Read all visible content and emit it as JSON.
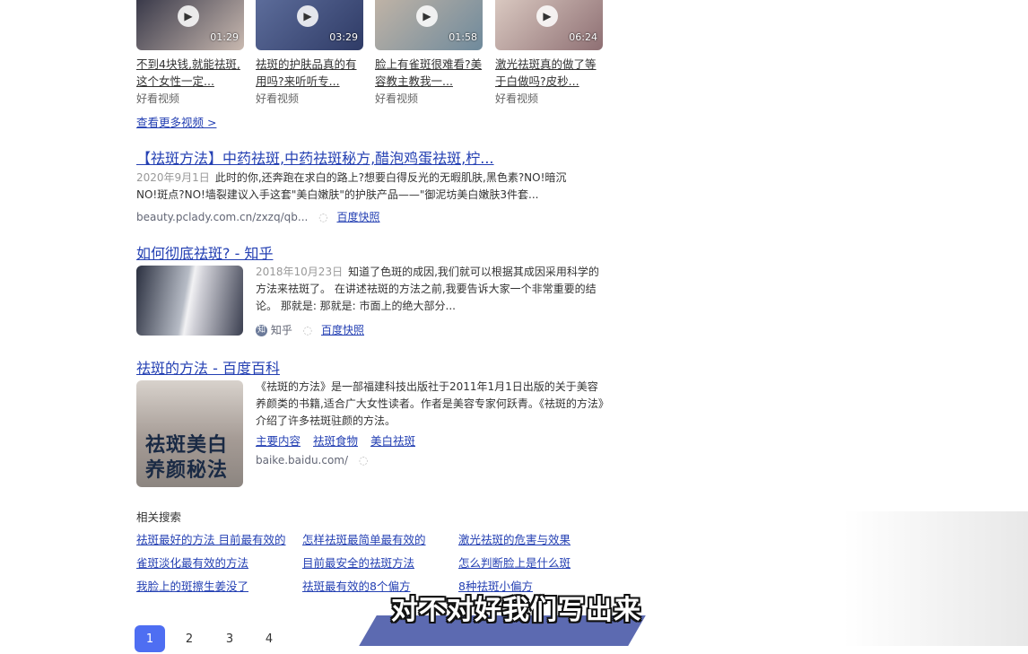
{
  "videos": [
    {
      "title": "不到4块钱,就能祛斑,这个女性一定...",
      "duration": "01:29",
      "source": "好看视频"
    },
    {
      "title": "祛斑的护肤品真的有用吗?来听听专...",
      "duration": "03:29",
      "source": "好看视频"
    },
    {
      "title": "脸上有雀斑很难看?美容教主教我一...",
      "duration": "01:58",
      "source": "好看视频"
    },
    {
      "title": "激光祛斑真的做了等于白做吗?皮秒...",
      "duration": "06:24",
      "source": "好看视频"
    }
  ],
  "more_videos": "查看更多视频 >",
  "results": [
    {
      "title": "【祛斑方法】中药祛斑,中药祛斑秘方,醋泡鸡蛋祛斑,柠...",
      "date": "2020年9月1日",
      "abstract": "此时的你,还奔跑在求白的路上?想要白得反光的无暇肌肤,黑色素?NO!暗沉NO!斑点?NO!墙裂建议入手这套\"美白嫩肤\"的护肤产品——\"御泥坊美白嫩肤3件套...",
      "url": "beauty.pclady.com.cn/zxzq/qb...",
      "snapshot": "百度快照"
    },
    {
      "title": "如何彻底祛斑? - 知乎",
      "date": "2018年10月23日",
      "abstract": "知道了色斑的成因,我们就可以根据其成因采用科学的方法来祛斑了。 在讲述祛斑的方法之前,我要告诉大家一个非常重要的结论。 那就是: 那就是: 市面上的绝大部分...",
      "source": "知乎",
      "snapshot": "百度快照"
    },
    {
      "title": "祛斑的方法 - 百度百科",
      "abstract": "《祛斑的方法》是一部福建科技出版社于2011年1月1日出版的关于美容养颜类的书籍,适合广大女性读者。作者是美容专家何跃青。《祛斑的方法》介绍了许多祛斑驻颜的方法。",
      "sublinks": [
        "主要内容",
        "祛斑食物",
        "美白祛斑"
      ],
      "url": "baike.baidu.com/",
      "book_cover_text": "祛斑美白养颜秘法"
    }
  ],
  "related": {
    "title": "相关搜索",
    "items": [
      "祛斑最好的方法 目前最有效的",
      "怎样祛斑最简单最有效的",
      "激光祛斑的危害与效果",
      "雀斑淡化最有效的方法",
      "目前最安全的祛斑方法",
      "怎么判断脸上是什么斑",
      "我脸上的斑擦生姜没了",
      "祛斑最有效的8个偏方",
      "8种祛斑小偏方"
    ]
  },
  "pagination": [
    "1",
    "2",
    "3",
    "4"
  ],
  "subtitle": "对不对好我们写出来"
}
